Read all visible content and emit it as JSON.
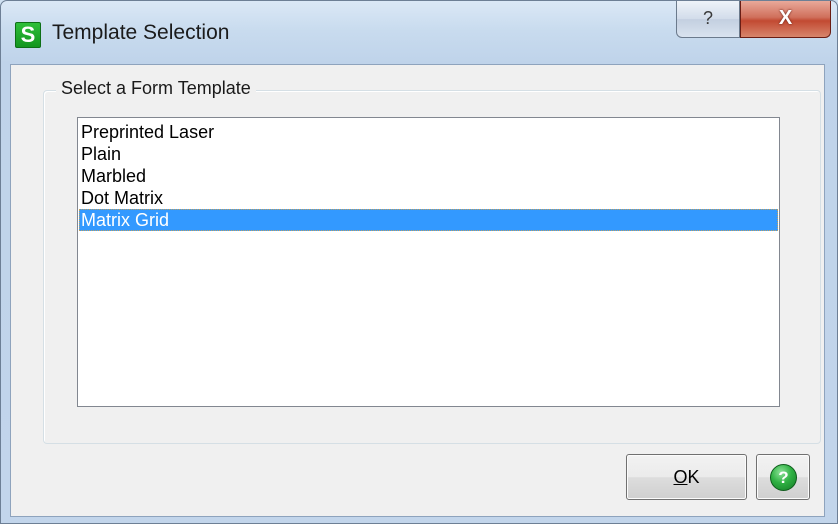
{
  "window": {
    "title": "Template Selection",
    "app_icon_letter": "S",
    "help_caption_glyph": "?",
    "close_caption_glyph": "X"
  },
  "group": {
    "label": "Select a Form Template"
  },
  "templates": [
    {
      "label": "Preprinted Laser",
      "selected": false
    },
    {
      "label": "Plain",
      "selected": false
    },
    {
      "label": "Marbled",
      "selected": false
    },
    {
      "label": "Dot Matrix",
      "selected": false
    },
    {
      "label": "Matrix Grid",
      "selected": true
    }
  ],
  "buttons": {
    "ok_mnemonic": "O",
    "ok_rest": "K",
    "help_glyph": "?"
  },
  "colors": {
    "selection": "#3399ff",
    "app_icon": "#1aa52a",
    "close_button": "#c75039"
  }
}
